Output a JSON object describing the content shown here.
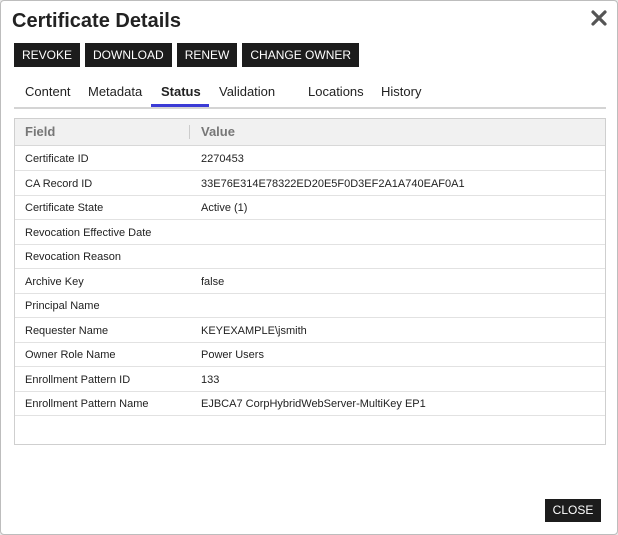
{
  "dialog": {
    "title": "Certificate Details",
    "close_icon": "close-x-icon",
    "close_button_label": "CLOSE"
  },
  "toolbar": {
    "buttons": [
      {
        "label": "REVOKE"
      },
      {
        "label": "DOWNLOAD"
      },
      {
        "label": "RENEW"
      },
      {
        "label": "CHANGE OWNER"
      }
    ]
  },
  "tabs": [
    {
      "label": "Content"
    },
    {
      "label": "Metadata"
    },
    {
      "label": "Status",
      "active": true
    },
    {
      "label": "Validation"
    },
    {
      "label": "Locations"
    },
    {
      "label": "History"
    }
  ],
  "grid": {
    "columns": [
      "Field",
      "Value"
    ],
    "rows": [
      {
        "field": "Certificate ID",
        "value": "2270453"
      },
      {
        "field": "CA Record ID",
        "value": "33E76E314E78322ED20E5F0D3EF2A1A740EAF0A1"
      },
      {
        "field": "Certificate State",
        "value": "Active (1)"
      },
      {
        "field": "Revocation Effective Date",
        "value": ""
      },
      {
        "field": "Revocation Reason",
        "value": ""
      },
      {
        "field": "Archive Key",
        "value": "false"
      },
      {
        "field": "Principal Name",
        "value": ""
      },
      {
        "field": "Requester Name",
        "value": "KEYEXAMPLE\\jsmith"
      },
      {
        "field": "Owner Role Name",
        "value": "Power Users"
      },
      {
        "field": "Enrollment Pattern ID",
        "value": "133"
      },
      {
        "field": "Enrollment Pattern Name",
        "value": "EJBCA7 CorpHybridWebServer-MultiKey EP1"
      }
    ]
  },
  "colors": {
    "button_bg": "#1c1c1c",
    "active_tab_underline": "#3b3bd6",
    "header_bg": "#f1f1f1"
  }
}
